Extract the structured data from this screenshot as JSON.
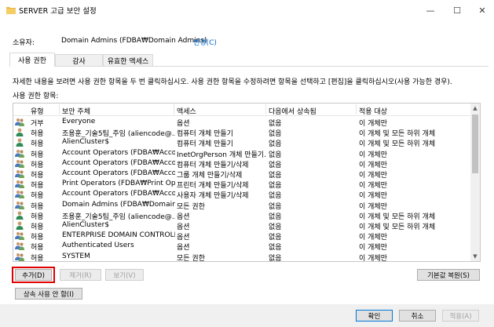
{
  "window": {
    "title": "SERVER 고급 보안 설정",
    "minimize_glyph": "—",
    "maximize_glyph": "☐",
    "close_glyph": "✕"
  },
  "owner": {
    "label": "소유자:",
    "value": "Domain Admins (FDBA₩Domain Admins)",
    "change_link": "변경(C)"
  },
  "tabs": [
    {
      "label": "사용 권한",
      "active": true
    },
    {
      "label": "감사",
      "active": false
    },
    {
      "label": "유효한 액세스",
      "active": false
    }
  ],
  "description": "자세한 내용을 보려면 사용 권한 항목을 두 번 클릭하십시오. 사용 권한 항목을 수정하려면 항목을 선택하고 [편집]을 클릭하십시오(사용 가능한 경우).",
  "entries_label": "사용 권한 항목:",
  "columns": {
    "type": "유형",
    "principal": "보안 주체",
    "access": "액세스",
    "inherited_from": "다음에서 상속됨",
    "applies_to": "적용 대상"
  },
  "rows": [
    {
      "icon": "group-icon",
      "type": "거부",
      "principal": "Everyone",
      "access": "옵션",
      "inherited": "없음",
      "applies": "이 개체만"
    },
    {
      "icon": "user-icon",
      "type": "허용",
      "principal": "조용훈_기술5팀_주임 (aliencode@...",
      "access": "컴퓨터 개체 만들기",
      "inherited": "없음",
      "applies": "이 개체 및 모든 하위 개체"
    },
    {
      "icon": "user-icon",
      "type": "허용",
      "principal": "AlienCluster$",
      "access": "컴퓨터 개체 만들기",
      "inherited": "없음",
      "applies": "이 개체 및 모든 하위 개체"
    },
    {
      "icon": "group-icon",
      "type": "허용",
      "principal": "Account Operators (FDBA₩Accou...",
      "access": "InetOrgPerson 개체 만들기...",
      "inherited": "없음",
      "applies": "이 개체만"
    },
    {
      "icon": "group-icon",
      "type": "허용",
      "principal": "Account Operators (FDBA₩Accou...",
      "access": "컴퓨터 개체 만들기/삭제",
      "inherited": "없음",
      "applies": "이 개체만"
    },
    {
      "icon": "group-icon",
      "type": "허용",
      "principal": "Account Operators (FDBA₩Accou...",
      "access": "그룹 개체 만들기/삭제",
      "inherited": "없음",
      "applies": "이 개체만"
    },
    {
      "icon": "group-icon",
      "type": "허용",
      "principal": "Print Operators (FDBA₩Print Oper...",
      "access": "프린터 개체 만들기/삭제",
      "inherited": "없음",
      "applies": "이 개체만"
    },
    {
      "icon": "group-icon",
      "type": "허용",
      "principal": "Account Operators (FDBA₩Accou...",
      "access": "사용자 개체 만들기/삭제",
      "inherited": "없음",
      "applies": "이 개체만"
    },
    {
      "icon": "group-icon",
      "type": "허용",
      "principal": "Domain Admins (FDBA₩Domain ...",
      "access": "모든 권한",
      "inherited": "없음",
      "applies": "이 개체만"
    },
    {
      "icon": "user-icon",
      "type": "허용",
      "principal": "조용훈_기술5팀_주임 (aliencode@...",
      "access": "옵션",
      "inherited": "없음",
      "applies": "이 개체 및 모든 하위 개체"
    },
    {
      "icon": "user-icon",
      "type": "허용",
      "principal": "AlienCluster$",
      "access": "옵션",
      "inherited": "없음",
      "applies": "이 개체 및 모든 하위 개체"
    },
    {
      "icon": "group-icon",
      "type": "허용",
      "principal": "ENTERPRISE DOMAIN CONTROLL...",
      "access": "옵션",
      "inherited": "없음",
      "applies": "이 개체만"
    },
    {
      "icon": "group-icon",
      "type": "허용",
      "principal": "Authenticated Users",
      "access": "옵션",
      "inherited": "없음",
      "applies": "이 개체만"
    },
    {
      "icon": "group-icon",
      "type": "허용",
      "principal": "SYSTEM",
      "access": "모든 권한",
      "inherited": "없음",
      "applies": "이 개체만"
    }
  ],
  "buttons": {
    "add": "추가(D)",
    "remove": "제거(R)",
    "view": "보기(V)",
    "restore_defaults": "기본값 복원(S)",
    "disable_inheritance": "상속 사용 안 함(I)",
    "ok": "확인",
    "cancel": "취소",
    "apply": "적용(A)"
  },
  "colors": {
    "link": "#0066cc",
    "highlight": "#e00000",
    "user_icon_green": "#2e8b57",
    "group_icon_blue": "#4a78c0"
  }
}
